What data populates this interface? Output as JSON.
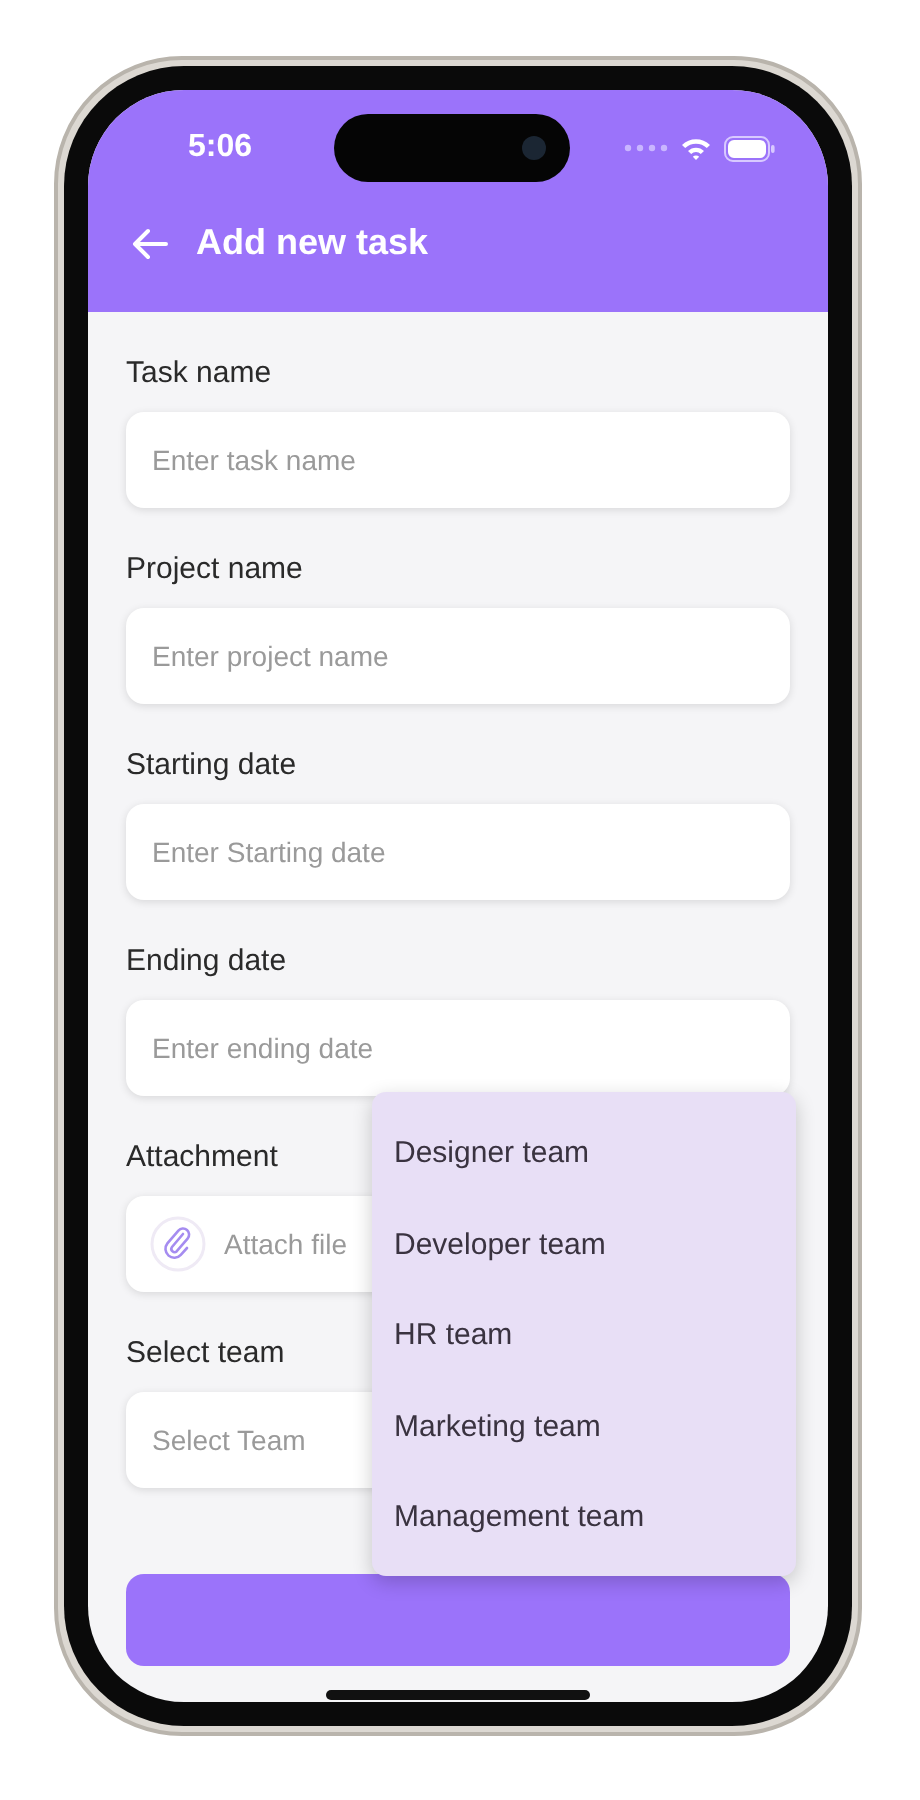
{
  "status_bar": {
    "time": "5:06"
  },
  "header": {
    "title": "Add new task"
  },
  "fields": [
    {
      "kind": "text",
      "label": "Task name",
      "placeholder": "Enter task name"
    },
    {
      "kind": "text",
      "label": "Project name",
      "placeholder": "Enter project name"
    },
    {
      "kind": "text",
      "label": "Starting date",
      "placeholder": "Enter Starting date"
    },
    {
      "kind": "text",
      "label": "Ending date",
      "placeholder": "Enter ending date"
    },
    {
      "kind": "attachment",
      "label": "Attachment",
      "placeholder": "Attach file"
    },
    {
      "kind": "select",
      "label": "Select team",
      "placeholder": "Select Team"
    }
  ],
  "team_menu": {
    "items": [
      "Designer team",
      "Developer team",
      "HR team",
      "Marketing team",
      "Management team"
    ]
  }
}
